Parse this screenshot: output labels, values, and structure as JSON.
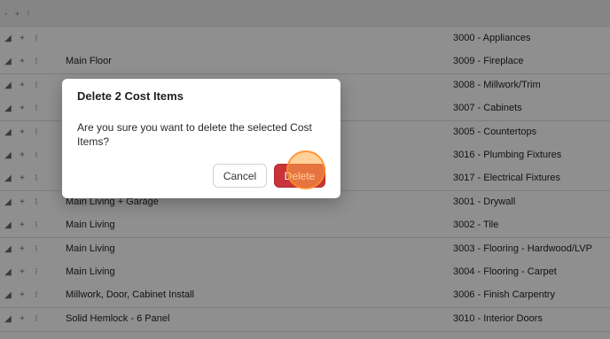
{
  "rows": [
    {
      "location": "",
      "cost_code": "3000 - Appliances"
    },
    {
      "location": "Main Floor",
      "cost_code": "3009 - Fireplace"
    },
    {
      "location": "",
      "cost_code": "3008 - Millwork/Trim"
    },
    {
      "location": "",
      "cost_code": "3007 - Cabinets"
    },
    {
      "location": "",
      "cost_code": "3005 - Countertops"
    },
    {
      "location": "",
      "cost_code": "3016 - Plumbing Fixtures"
    },
    {
      "location": "",
      "cost_code": "3017 - Electrical Fixtures"
    },
    {
      "location": "Main Living + Garage",
      "cost_code": "3001 - Drywall"
    },
    {
      "location": "Main Living",
      "cost_code": "3002 - Tile"
    },
    {
      "location": "Main Living",
      "cost_code": "3003 - Flooring - Hardwood/LVP"
    },
    {
      "location": "Main Living",
      "cost_code": "3004 - Flooring - Carpet"
    },
    {
      "location": "Millwork, Door, Cabinet Install",
      "cost_code": "3006 - Finish Carpentry"
    },
    {
      "location": "Solid Hemlock - 6 Panel",
      "cost_code": "3010 - Interior Doors"
    }
  ],
  "row_icons": [
    "drag-handle-icon",
    "expand-icon",
    "more-icon"
  ],
  "dialog": {
    "title": "Delete 2 Cost Items",
    "message": "Are you sure you want to delete the selected Cost Items?",
    "cancel_label": "Cancel",
    "delete_label": "Delete"
  },
  "colors": {
    "delete_button": "#c8343a",
    "overlay": "rgba(0,0,0,0.42)",
    "cursor_highlight": "#ffaa46"
  }
}
